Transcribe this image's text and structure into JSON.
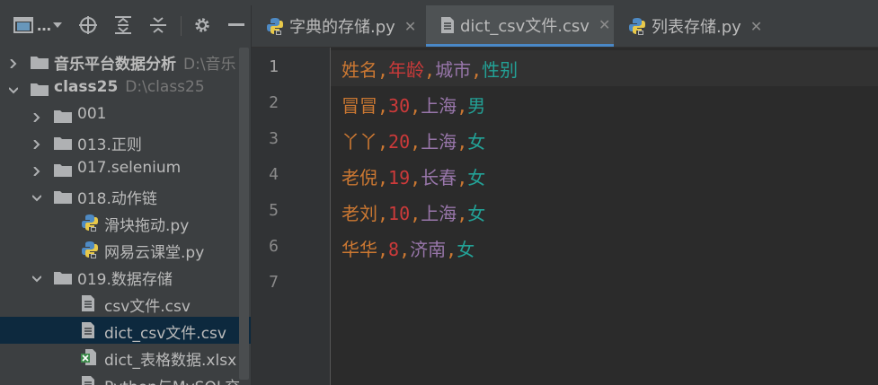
{
  "project_panel": {
    "title": "…",
    "tree": [
      {
        "name": "音乐平台数据分析",
        "path": "D:\\音乐",
        "type": "folder",
        "expanded": false,
        "bold": true
      },
      {
        "name": "class25",
        "path": "D:\\class25",
        "type": "folder",
        "expanded": true,
        "bold": true
      },
      {
        "name": "001",
        "type": "folder",
        "expanded": false
      },
      {
        "name": "013.正则",
        "type": "folder",
        "expanded": false
      },
      {
        "name": "017.selenium",
        "type": "folder",
        "expanded": false
      },
      {
        "name": "018.动作链",
        "type": "folder",
        "expanded": true
      },
      {
        "name": "滑块拖动.py",
        "type": "python"
      },
      {
        "name": "网易云课堂.py",
        "type": "python"
      },
      {
        "name": "019.数据存储",
        "type": "folder",
        "expanded": true
      },
      {
        "name": "csv文件.csv",
        "type": "text"
      },
      {
        "name": "dict_csv文件.csv",
        "type": "text",
        "selected": true
      },
      {
        "name": "dict_表格数据.xlsx",
        "type": "excel"
      },
      {
        "name": "Python与MySQL交",
        "type": "text"
      }
    ]
  },
  "tabs": [
    {
      "label": "字典的存储.py",
      "icon": "python-icon",
      "active": false
    },
    {
      "label": "dict_csv文件.csv",
      "icon": "text-file-icon",
      "active": true
    },
    {
      "label": "列表存储.py",
      "icon": "python-icon",
      "active": false
    }
  ],
  "editor": {
    "line_numbers": [
      "1",
      "2",
      "3",
      "4",
      "5",
      "6",
      "7"
    ],
    "current_line": 1,
    "rows": [
      [
        "姓名",
        "年龄",
        "城市",
        "性别"
      ],
      [
        "冒冒",
        "30",
        "上海",
        "男"
      ],
      [
        "丫丫",
        "20",
        "上海",
        "女"
      ],
      [
        "老倪",
        "19",
        "长春",
        "女"
      ],
      [
        "老刘",
        "10",
        "上海",
        "女"
      ],
      [
        "华华",
        "8",
        "济南",
        "女"
      ]
    ],
    "separator": ","
  },
  "colors": {
    "col1": "#cc7832",
    "col2": "#cc3a3a",
    "col3": "#9876aa",
    "col4": "#23a196",
    "accent": "#4a88c7",
    "selection": "#0d293e"
  }
}
